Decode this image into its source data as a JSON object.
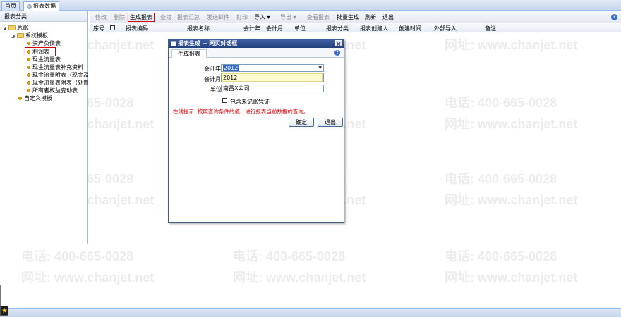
{
  "tabs": [
    {
      "label": "首页"
    },
    {
      "label": "报表数据"
    }
  ],
  "tree": {
    "header": "报表分类",
    "root": "总账",
    "system": "系统模板",
    "items": [
      "资产负债表",
      "利润表",
      "现金流量表",
      "现金流量表补充资料",
      "现金流量附表（现金及E",
      "现金流量表附表（处置子",
      "所有者权益变动表"
    ],
    "custom": "自定义模板"
  },
  "toolbar": {
    "items": [
      "修改",
      "删除",
      "生成报表",
      "查找",
      "报表汇总",
      "发送邮件",
      "打印",
      "导入 ▾",
      "导出 ▾",
      "查看报表",
      "批量生成",
      "刷新",
      "退出"
    ],
    "help_icon": "?"
  },
  "grid": {
    "columns": [
      "序号",
      "报表编码",
      "报表名称",
      "会计年",
      "会计月",
      "单位",
      "报表分类",
      "报表创建人",
      "创建时间",
      "外部导入",
      "备注"
    ]
  },
  "dialog": {
    "title": "报表生成  --  网页对话框",
    "close": "×",
    "tab": "生成报表",
    "help": "?",
    "year_label": "会计年",
    "year_value": "2012",
    "month_label": "会计月",
    "month_value": "2012",
    "unit_label": "单位",
    "unit_value": "南昌X公司",
    "include_label": "包含未记账凭证",
    "tip": "在线提示: 按照查询条件的值，进行报表当前数据的查询。",
    "ok": "确定",
    "exit": "退出"
  },
  "watermark": {
    "phone": "电话: 400-665-0028",
    "site": "网址: www.chanjet.net"
  },
  "colors": {
    "accent": "#d40000",
    "title_bar": "#2b4a8c",
    "tip": "#dd0000"
  }
}
